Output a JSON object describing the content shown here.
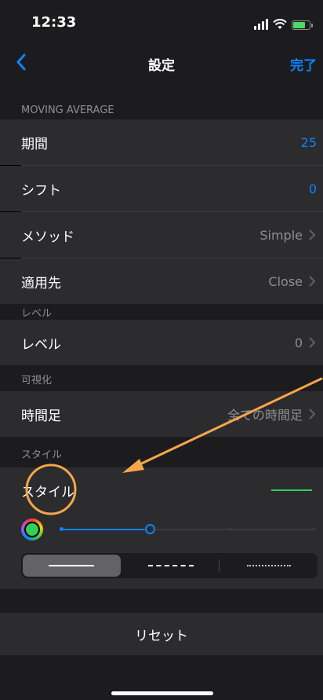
{
  "status_bar": {
    "time": "12:33"
  },
  "nav": {
    "title": "設定",
    "done_label": "完了"
  },
  "sections": {
    "moving_average": {
      "header": "MOVING AVERAGE",
      "rows": [
        {
          "label": "期間",
          "value": "25"
        },
        {
          "label": "シフト",
          "value": "0"
        },
        {
          "label": "メソッド",
          "value": "Simple"
        },
        {
          "label": "適用先",
          "value": "Close"
        }
      ]
    },
    "level": {
      "header": "レベル",
      "row": {
        "label": "レベル",
        "value": "0"
      }
    },
    "visualization": {
      "header": "可視化",
      "row": {
        "label": "時間足",
        "value": "全ての時間足"
      }
    },
    "style": {
      "header": "スタイル",
      "row": {
        "label": "スタイル"
      }
    }
  },
  "style_options": {
    "line_color": "#30d158",
    "thickness_level": 0.35,
    "line_types": [
      "solid",
      "dashed",
      "dotted"
    ],
    "selected_line_type": "solid"
  },
  "reset_label": "リセット",
  "colors": {
    "accent": "#0a84ff",
    "annotation": "#f5a64a"
  }
}
